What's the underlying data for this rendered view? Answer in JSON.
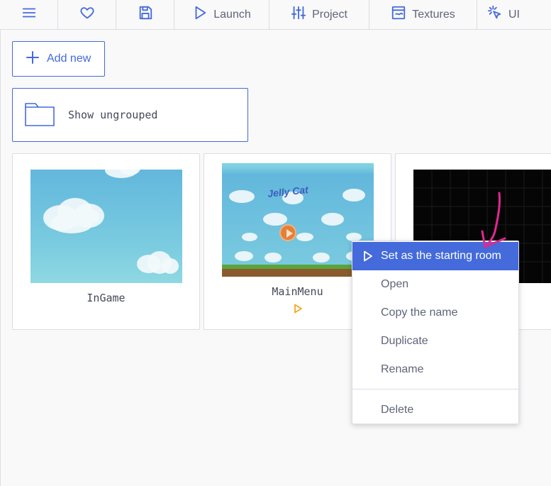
{
  "toolbar": {
    "items": [
      {
        "icon": "menu-icon",
        "label": ""
      },
      {
        "icon": "heart-icon",
        "label": ""
      },
      {
        "icon": "save-icon",
        "label": ""
      },
      {
        "icon": "play-icon",
        "label": "Launch"
      },
      {
        "icon": "sliders-icon",
        "label": "Project"
      },
      {
        "icon": "texture-icon",
        "label": "Textures"
      },
      {
        "icon": "pointer-click-icon",
        "label": "UI"
      }
    ]
  },
  "actions": {
    "add_new_label": "Add new",
    "show_ungrouped_label": "Show ungrouped"
  },
  "rooms": [
    {
      "name": "InGame",
      "is_start": false
    },
    {
      "name": "MainMenu",
      "is_start": true,
      "logo_text": "Jelly Cat"
    },
    {
      "name": "",
      "is_start": false
    }
  ],
  "context_menu": {
    "items": [
      {
        "label": "Set as the starting room",
        "icon": "play-icon",
        "active": true
      },
      {
        "label": "Open"
      },
      {
        "label": "Copy the name"
      },
      {
        "label": "Duplicate"
      },
      {
        "label": "Rename"
      },
      {
        "label": "Delete"
      }
    ]
  },
  "colors": {
    "accent": "#446adb",
    "annotation": "#e0288f",
    "start_marker": "#f5a623"
  }
}
